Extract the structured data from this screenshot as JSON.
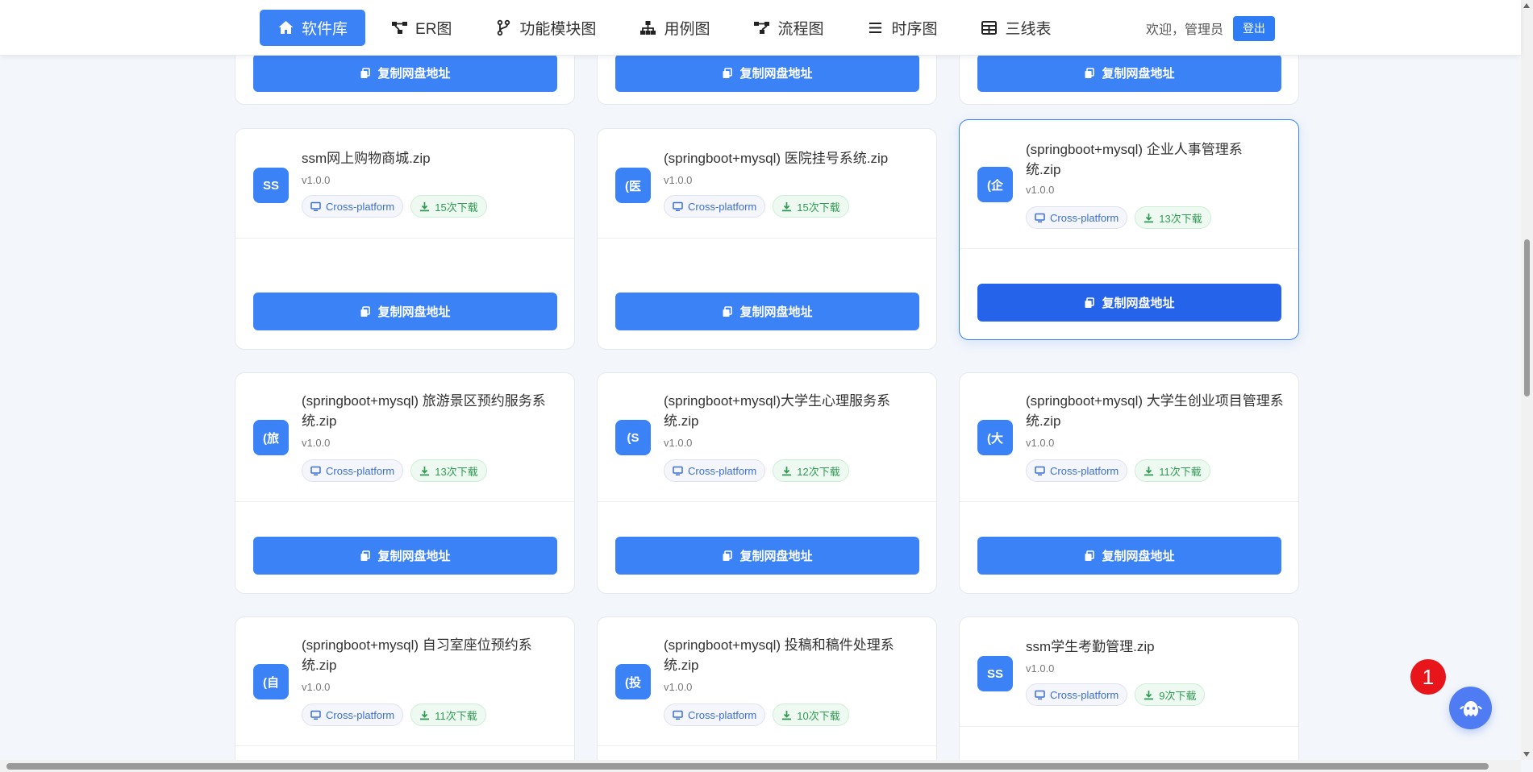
{
  "nav": {
    "items": [
      {
        "label": "软件库",
        "icon": "home-icon"
      },
      {
        "label": "ER图",
        "icon": "diagram-icon"
      },
      {
        "label": "功能模块图",
        "icon": "branch-icon"
      },
      {
        "label": "用例图",
        "icon": "sitemap-icon"
      },
      {
        "label": "流程图",
        "icon": "flow-icon"
      },
      {
        "label": "时序图",
        "icon": "list-icon"
      },
      {
        "label": "三线表",
        "icon": "table-icon"
      }
    ],
    "welcome": "欢迎，管理员",
    "logout": "登出"
  },
  "copy_label": "复制网盘地址",
  "cards": [
    {
      "avatar": "SS",
      "title": "ssm网上购物商城.zip",
      "version": "v1.0.0",
      "platform": "Cross-platform",
      "downloads": "15次下载"
    },
    {
      "avatar": "(医",
      "title": "(springboot+mysql) 医院挂号系统.zip",
      "version": "v1.0.0",
      "platform": "Cross-platform",
      "downloads": "15次下载"
    },
    {
      "avatar": "(企",
      "title": "(springboot+mysql) 企业人事管理系统.zip",
      "version": "v1.0.0",
      "platform": "Cross-platform",
      "downloads": "13次下载"
    },
    {
      "avatar": "(旅",
      "title": "(springboot+mysql) 旅游景区预约服务系统.zip",
      "version": "v1.0.0",
      "platform": "Cross-platform",
      "downloads": "13次下载"
    },
    {
      "avatar": "(S",
      "title": "(springboot+mysql)大学生心理服务系统.zip",
      "version": "v1.0.0",
      "platform": "Cross-platform",
      "downloads": "12次下载"
    },
    {
      "avatar": "(大",
      "title": "(springboot+mysql) 大学生创业项目管理系统.zip",
      "version": "v1.0.0",
      "platform": "Cross-platform",
      "downloads": "11次下载"
    },
    {
      "avatar": "(自",
      "title": "(springboot+mysql) 自习室座位预约系统.zip",
      "version": "v1.0.0",
      "platform": "Cross-platform",
      "downloads": "11次下载"
    },
    {
      "avatar": "(投",
      "title": "(springboot+mysql) 投稿和稿件处理系统.zip",
      "version": "v1.0.0",
      "platform": "Cross-platform",
      "downloads": "10次下载"
    },
    {
      "avatar": "SS",
      "title": "ssm学生考勤管理.zip",
      "version": "v1.0.0",
      "platform": "Cross-platform",
      "downloads": "9次下载"
    }
  ],
  "notification_count": "1",
  "colors": {
    "primary": "#3b82f6",
    "primary_dark": "#2563eb",
    "badge_red": "#e8151b"
  }
}
